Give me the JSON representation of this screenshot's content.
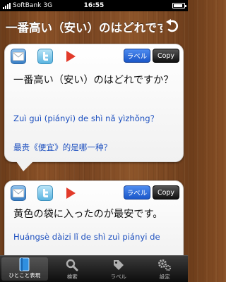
{
  "status_bar": {
    "carrier": "SoftBank",
    "network": "3G",
    "time": "16:55"
  },
  "nav": {
    "title": "一番高い（安い）のはどれですか？"
  },
  "cards": [
    {
      "label_button": "ラベル",
      "copy_button": "Copy",
      "japanese": "一番高い（安い）のはどれですか？",
      "pinyin": "Zuì guì (piányi) de shì nǎ yìzhǒng？",
      "chinese": "最贵《便宜》的是哪一种？"
    },
    {
      "label_button": "ラベル",
      "copy_button": "Copy",
      "japanese": "黄色の袋に入ったのが最安です。",
      "pinyin": "Huángsè dàizi lǐ de shì zuì piányi de"
    }
  ],
  "tabs": [
    {
      "label": "ひとこと表現",
      "icon": "book-icon",
      "active": true
    },
    {
      "label": "検索",
      "icon": "search-icon",
      "active": false
    },
    {
      "label": "ラベル",
      "icon": "tag-icon",
      "active": false
    },
    {
      "label": "設定",
      "icon": "gear-icon",
      "active": false
    }
  ],
  "colors": {
    "accent_blue": "#1c4fbf",
    "label_button": "#2a66dd",
    "copy_button": "#222222",
    "wood": "#7d4a22"
  }
}
